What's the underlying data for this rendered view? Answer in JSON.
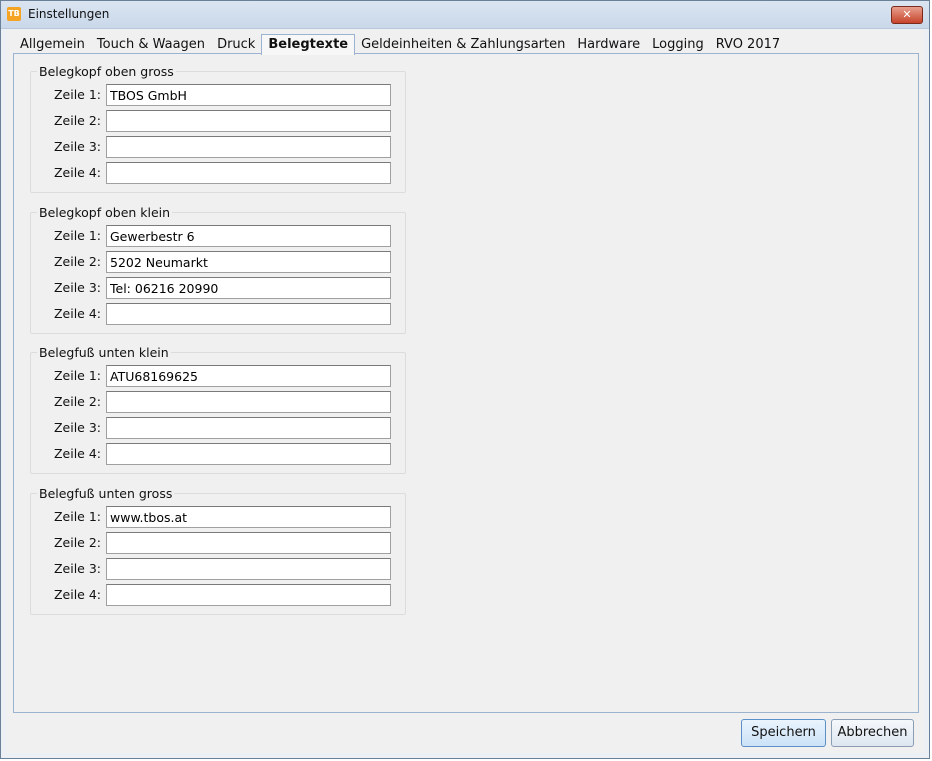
{
  "window": {
    "title": "Einstellungen",
    "app_icon": "TB",
    "close_glyph": "✕"
  },
  "tabs": [
    {
      "label": "Allgemein",
      "active": false
    },
    {
      "label": "Touch & Waagen",
      "active": false
    },
    {
      "label": "Druck",
      "active": false
    },
    {
      "label": "Belegtexte",
      "active": true
    },
    {
      "label": "Geldeinheiten & Zahlungsarten",
      "active": false
    },
    {
      "label": "Hardware",
      "active": false
    },
    {
      "label": "Logging",
      "active": false
    },
    {
      "label": "RVO 2017",
      "active": false
    }
  ],
  "groups": [
    {
      "title": "Belegkopf oben gross",
      "rows": [
        {
          "label": "Zeile 1:",
          "value": "TBOS GmbH"
        },
        {
          "label": "Zeile 2:",
          "value": ""
        },
        {
          "label": "Zeile 3:",
          "value": ""
        },
        {
          "label": "Zeile 4:",
          "value": ""
        }
      ]
    },
    {
      "title": "Belegkopf oben klein",
      "rows": [
        {
          "label": "Zeile 1:",
          "value": "Gewerbestr 6"
        },
        {
          "label": "Zeile 2:",
          "value": "5202 Neumarkt"
        },
        {
          "label": "Zeile 3:",
          "value": "Tel: 06216 20990"
        },
        {
          "label": "Zeile 4:",
          "value": ""
        }
      ]
    },
    {
      "title": "Belegfuß unten klein",
      "rows": [
        {
          "label": "Zeile 1:",
          "value": "ATU68169625"
        },
        {
          "label": "Zeile 2:",
          "value": ""
        },
        {
          "label": "Zeile 3:",
          "value": ""
        },
        {
          "label": "Zeile 4:",
          "value": ""
        }
      ]
    },
    {
      "title": "Belegfuß unten gross",
      "rows": [
        {
          "label": "Zeile 1:",
          "value": "www.tbos.at"
        },
        {
          "label": "Zeile 2:",
          "value": ""
        },
        {
          "label": "Zeile 3:",
          "value": ""
        },
        {
          "label": "Zeile 4:",
          "value": ""
        }
      ]
    }
  ],
  "buttons": {
    "save_label": "Speichern",
    "cancel_label": "Abbrechen"
  },
  "colors": {
    "accent": "#5b8fc7",
    "close_button": "#c7432a"
  }
}
